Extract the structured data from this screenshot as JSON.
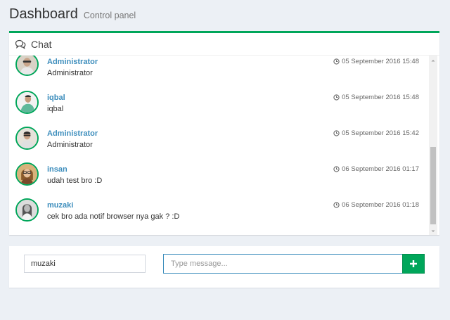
{
  "header": {
    "title": "Dashboard",
    "subtitle": "Control panel"
  },
  "chat": {
    "title": "Chat",
    "icon": "comments-icon",
    "accent_color": "#00a65a",
    "messages": [
      {
        "name": "Administrator",
        "text": "Administrator",
        "time": "05 September 2016 15:48"
      },
      {
        "name": "iqbal",
        "text": "iqbal",
        "time": "05 September 2016 15:48"
      },
      {
        "name": "Administrator",
        "text": "Administrator",
        "time": "05 September 2016 15:42"
      },
      {
        "name": "insan",
        "text": "udah test bro :D",
        "time": "06 September 2016 01:17"
      },
      {
        "name": "muzaki",
        "text": "cek bro ada notif browser nya gak ? :D",
        "time": "06 September 2016 01:18"
      }
    ]
  },
  "composer": {
    "username_value": "muzaki",
    "message_placeholder": "Type message...",
    "send_icon": "plus-icon"
  }
}
